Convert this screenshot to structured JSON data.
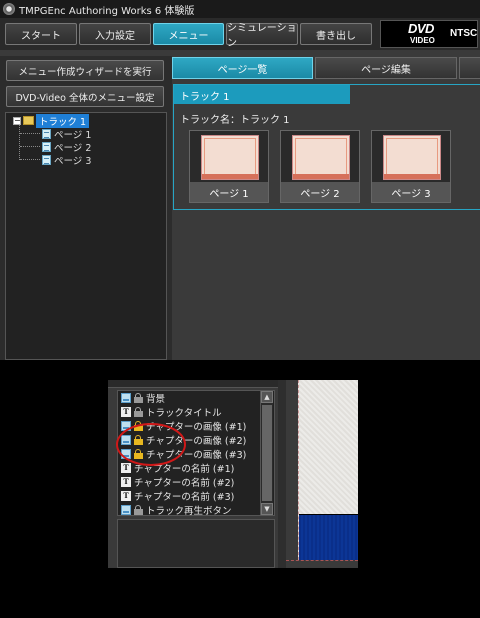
{
  "app": {
    "title": "TMPGEnc Authoring Works 6 体験版"
  },
  "toolbar": {
    "start": "スタート",
    "input": "入力設定",
    "menu": "メニュー",
    "simulation": "シミュレーション",
    "write": "書き出し",
    "active_tab": "menu"
  },
  "badge": {
    "dvd": "DVD",
    "video": "VIDEO",
    "format": "NTSC"
  },
  "left_panel": {
    "wizard_button": "メニュー作成ウィザードを実行",
    "dvd_menu_button": "DVD-Video 全体のメニュー設定",
    "tree": {
      "toggle": "−",
      "root": "トラック 1",
      "children": [
        "ページ 1",
        "ページ 2",
        "ページ 3"
      ]
    }
  },
  "right_panel": {
    "tabs": [
      "ページ一覧",
      "ページ編集"
    ],
    "active_tab": "ページ一覧",
    "track_header": "トラック 1",
    "track_name": "トラック名：トラック 1",
    "pages": [
      "ページ 1",
      "ページ 2",
      "ページ 3"
    ]
  },
  "layer_list": {
    "items": [
      {
        "icon": "image",
        "lock": "gray",
        "label": "背景"
      },
      {
        "icon": "text",
        "lock": "gray",
        "label": "トラックタイトル"
      },
      {
        "icon": "image",
        "lock": "gold",
        "label": "チャプターの画像 (#1)"
      },
      {
        "icon": "image",
        "lock": "gold",
        "label": "チャプターの画像 (#2)"
      },
      {
        "icon": "image",
        "lock": "gold",
        "label": "チャプターの画像 (#3)"
      },
      {
        "icon": "text",
        "lock": "none",
        "label": "チャプターの名前 (#1)"
      },
      {
        "icon": "text",
        "lock": "none",
        "label": "チャプターの名前 (#2)"
      },
      {
        "icon": "text",
        "lock": "none",
        "label": "チャプターの名前 (#3)"
      },
      {
        "icon": "image",
        "lock": "gray",
        "label": "トラック再生ボタン"
      }
    ],
    "highlight": "red-circle-annotation"
  },
  "colors": {
    "accent": "#1c9bbd",
    "selection": "#1f7fd6",
    "annotation": "#d01818",
    "preview_band": "#0c3696"
  }
}
